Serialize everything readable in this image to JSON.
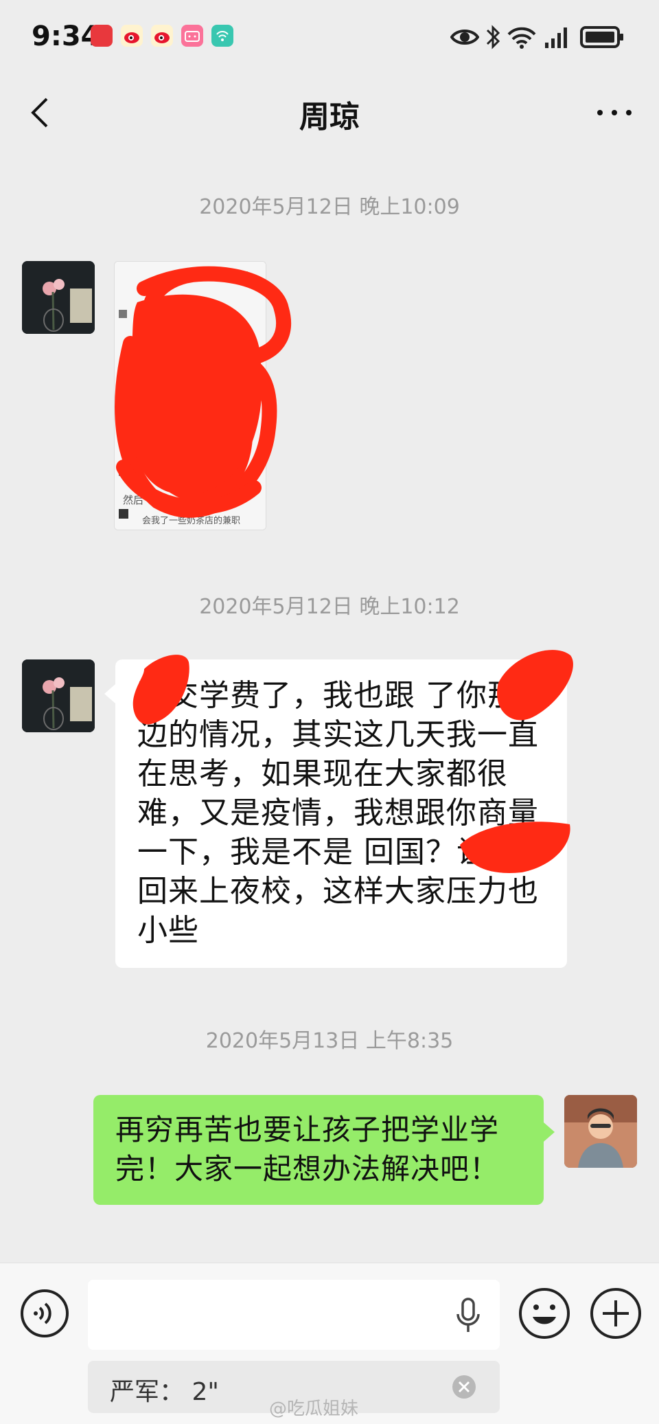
{
  "status_bar": {
    "time": "9:34",
    "app_icons": [
      {
        "name": "huawei-icon",
        "color": "#e8383d"
      },
      {
        "name": "weibo-icon",
        "color": "#f5b81e"
      },
      {
        "name": "weibo-icon-2",
        "color": "#f5b81e"
      },
      {
        "name": "bilibili-icon",
        "color": "#fb7299"
      },
      {
        "name": "app-icon",
        "color": "#39c7b0"
      }
    ]
  },
  "nav": {
    "title": "周琼"
  },
  "messages": [
    {
      "type": "timestamp",
      "text": "2020年5月12日 晚上10:09"
    },
    {
      "type": "image",
      "caption_1": "然后",
      "caption_2": "会我了一些奶茶店的兼职"
    },
    {
      "type": "timestamp",
      "text": "2020年5月12日 晚上10:12"
    },
    {
      "type": "text",
      "direction": "incoming",
      "text": "要交学费了，我也跟 了你那边的情况，其实这几天我一直在思考，如果现在大家都很难，又是疫情，我想跟你商量一下，我是不是 回国？让她回来上夜校，这样大家压力也小些"
    },
    {
      "type": "timestamp",
      "text": "2020年5月13日 上午8:35"
    },
    {
      "type": "text",
      "direction": "outgoing",
      "text": "再穷再苦也要让孩子把学业学完！大家一起想办法解决吧！"
    }
  ],
  "input_bar": {
    "quote": "严军：  2\""
  },
  "watermark": "@吃瓜姐妹",
  "colors": {
    "background": "#ededed",
    "outgoing_bubble": "#95ec69",
    "incoming_bubble": "#ffffff",
    "redaction": "#ff2a14"
  }
}
